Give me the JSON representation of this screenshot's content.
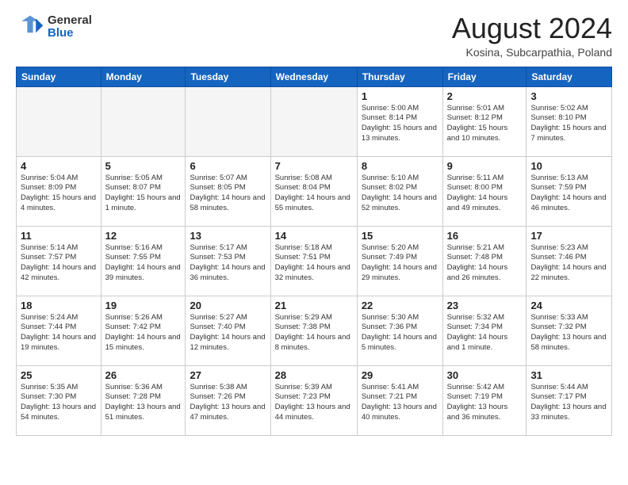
{
  "header": {
    "logo_general": "General",
    "logo_blue": "Blue",
    "month_year": "August 2024",
    "location": "Kosina, Subcarpathia, Poland"
  },
  "days_of_week": [
    "Sunday",
    "Monday",
    "Tuesday",
    "Wednesday",
    "Thursday",
    "Friday",
    "Saturday"
  ],
  "weeks": [
    [
      {
        "day": "",
        "empty": true
      },
      {
        "day": "",
        "empty": true
      },
      {
        "day": "",
        "empty": true
      },
      {
        "day": "",
        "empty": true
      },
      {
        "day": "1",
        "sunrise": "5:00 AM",
        "sunset": "8:14 PM",
        "daylight": "15 hours and 13 minutes."
      },
      {
        "day": "2",
        "sunrise": "5:01 AM",
        "sunset": "8:12 PM",
        "daylight": "15 hours and 10 minutes."
      },
      {
        "day": "3",
        "sunrise": "5:02 AM",
        "sunset": "8:10 PM",
        "daylight": "15 hours and 7 minutes."
      }
    ],
    [
      {
        "day": "4",
        "sunrise": "5:04 AM",
        "sunset": "8:09 PM",
        "daylight": "15 hours and 4 minutes."
      },
      {
        "day": "5",
        "sunrise": "5:05 AM",
        "sunset": "8:07 PM",
        "daylight": "15 hours and 1 minute."
      },
      {
        "day": "6",
        "sunrise": "5:07 AM",
        "sunset": "8:05 PM",
        "daylight": "14 hours and 58 minutes."
      },
      {
        "day": "7",
        "sunrise": "5:08 AM",
        "sunset": "8:04 PM",
        "daylight": "14 hours and 55 minutes."
      },
      {
        "day": "8",
        "sunrise": "5:10 AM",
        "sunset": "8:02 PM",
        "daylight": "14 hours and 52 minutes."
      },
      {
        "day": "9",
        "sunrise": "5:11 AM",
        "sunset": "8:00 PM",
        "daylight": "14 hours and 49 minutes."
      },
      {
        "day": "10",
        "sunrise": "5:13 AM",
        "sunset": "7:59 PM",
        "daylight": "14 hours and 46 minutes."
      }
    ],
    [
      {
        "day": "11",
        "sunrise": "5:14 AM",
        "sunset": "7:57 PM",
        "daylight": "14 hours and 42 minutes."
      },
      {
        "day": "12",
        "sunrise": "5:16 AM",
        "sunset": "7:55 PM",
        "daylight": "14 hours and 39 minutes."
      },
      {
        "day": "13",
        "sunrise": "5:17 AM",
        "sunset": "7:53 PM",
        "daylight": "14 hours and 36 minutes."
      },
      {
        "day": "14",
        "sunrise": "5:18 AM",
        "sunset": "7:51 PM",
        "daylight": "14 hours and 32 minutes."
      },
      {
        "day": "15",
        "sunrise": "5:20 AM",
        "sunset": "7:49 PM",
        "daylight": "14 hours and 29 minutes."
      },
      {
        "day": "16",
        "sunrise": "5:21 AM",
        "sunset": "7:48 PM",
        "daylight": "14 hours and 26 minutes."
      },
      {
        "day": "17",
        "sunrise": "5:23 AM",
        "sunset": "7:46 PM",
        "daylight": "14 hours and 22 minutes."
      }
    ],
    [
      {
        "day": "18",
        "sunrise": "5:24 AM",
        "sunset": "7:44 PM",
        "daylight": "14 hours and 19 minutes."
      },
      {
        "day": "19",
        "sunrise": "5:26 AM",
        "sunset": "7:42 PM",
        "daylight": "14 hours and 15 minutes."
      },
      {
        "day": "20",
        "sunrise": "5:27 AM",
        "sunset": "7:40 PM",
        "daylight": "14 hours and 12 minutes."
      },
      {
        "day": "21",
        "sunrise": "5:29 AM",
        "sunset": "7:38 PM",
        "daylight": "14 hours and 8 minutes."
      },
      {
        "day": "22",
        "sunrise": "5:30 AM",
        "sunset": "7:36 PM",
        "daylight": "14 hours and 5 minutes."
      },
      {
        "day": "23",
        "sunrise": "5:32 AM",
        "sunset": "7:34 PM",
        "daylight": "14 hours and 1 minute."
      },
      {
        "day": "24",
        "sunrise": "5:33 AM",
        "sunset": "7:32 PM",
        "daylight": "13 hours and 58 minutes."
      }
    ],
    [
      {
        "day": "25",
        "sunrise": "5:35 AM",
        "sunset": "7:30 PM",
        "daylight": "13 hours and 54 minutes."
      },
      {
        "day": "26",
        "sunrise": "5:36 AM",
        "sunset": "7:28 PM",
        "daylight": "13 hours and 51 minutes."
      },
      {
        "day": "27",
        "sunrise": "5:38 AM",
        "sunset": "7:26 PM",
        "daylight": "13 hours and 47 minutes."
      },
      {
        "day": "28",
        "sunrise": "5:39 AM",
        "sunset": "7:23 PM",
        "daylight": "13 hours and 44 minutes."
      },
      {
        "day": "29",
        "sunrise": "5:41 AM",
        "sunset": "7:21 PM",
        "daylight": "13 hours and 40 minutes."
      },
      {
        "day": "30",
        "sunrise": "5:42 AM",
        "sunset": "7:19 PM",
        "daylight": "13 hours and 36 minutes."
      },
      {
        "day": "31",
        "sunrise": "5:44 AM",
        "sunset": "7:17 PM",
        "daylight": "13 hours and 33 minutes."
      }
    ]
  ]
}
